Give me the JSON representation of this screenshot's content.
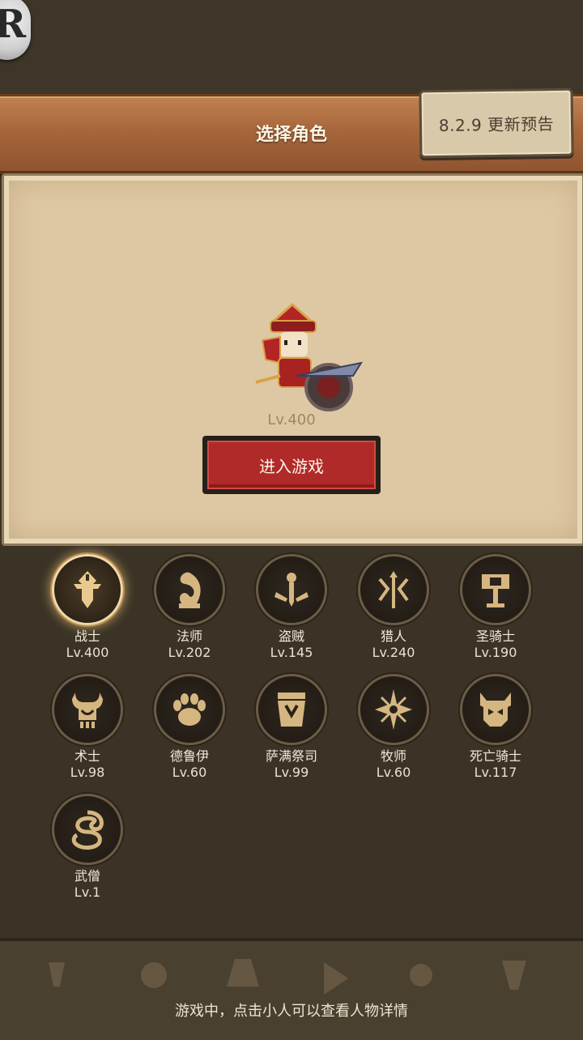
{
  "header": {
    "title": "选择角色",
    "update_tag": "8.2.9 更新预告"
  },
  "logo": {
    "letter": "R"
  },
  "character": {
    "level": "Lv.400",
    "enter_label": "进入游戏"
  },
  "classes": [
    {
      "name": "战士",
      "level": "Lv.400",
      "icon": "warrior-icon",
      "active": true
    },
    {
      "name": "法师",
      "level": "Lv.202",
      "icon": "mage-icon"
    },
    {
      "name": "盗贼",
      "level": "Lv.145",
      "icon": "rogue-icon"
    },
    {
      "name": "猎人",
      "level": "Lv.240",
      "icon": "hunter-icon"
    },
    {
      "name": "圣骑士",
      "level": "Lv.190",
      "icon": "paladin-icon"
    },
    {
      "name": "术士",
      "level": "Lv.98",
      "icon": "warlock-icon"
    },
    {
      "name": "德鲁伊",
      "level": "Lv.60",
      "icon": "druid-icon"
    },
    {
      "name": "萨满祭司",
      "level": "Lv.99",
      "icon": "shaman-icon"
    },
    {
      "name": "牧师",
      "level": "Lv.60",
      "icon": "priest-icon"
    },
    {
      "name": "死亡骑士",
      "level": "Lv.117",
      "icon": "death-knight-icon"
    },
    {
      "name": "武僧",
      "level": "Lv.1",
      "icon": "monk-icon"
    }
  ],
  "footer": {
    "hint": "游戏中，点击小人可以查看人物详情"
  },
  "colors": {
    "header_wood": "#a8673b",
    "panel_parchment": "#dec8a3",
    "enter_button": "#b02a2a",
    "class_gold": "#d6b680"
  }
}
